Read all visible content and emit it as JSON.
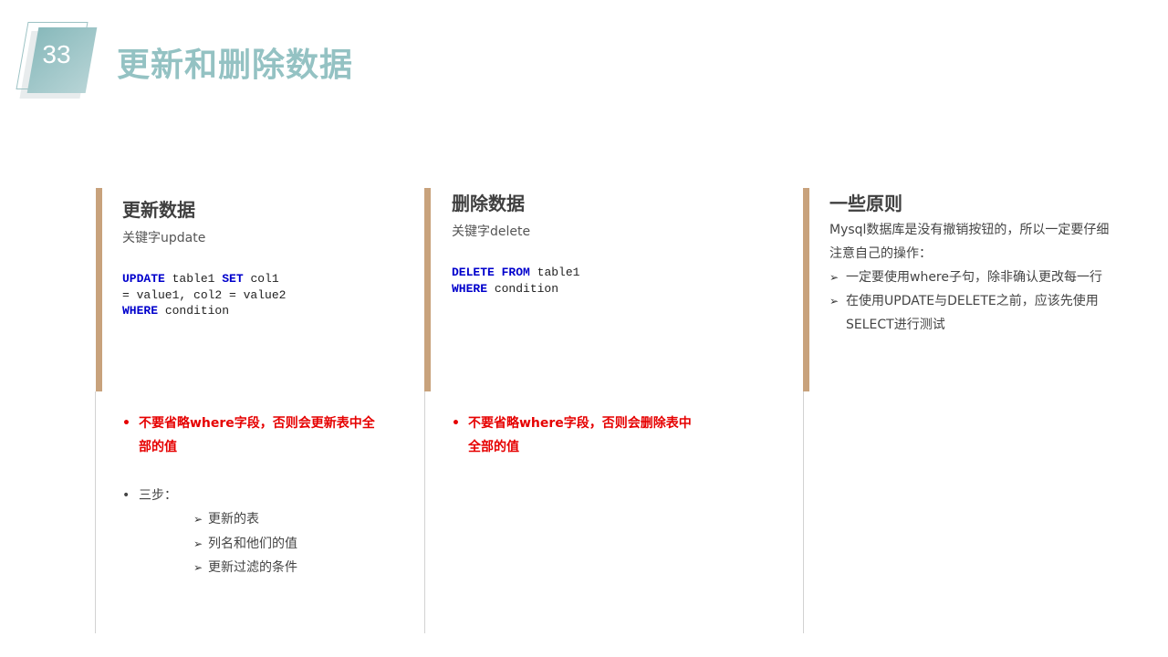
{
  "slide": {
    "number": "33",
    "title": "更新和删除数据"
  },
  "colors": {
    "title": "#94c2c3",
    "accent": "#c8a27c",
    "warning": "#e60000",
    "keyword": "#0000cc"
  },
  "update": {
    "title": "更新数据",
    "keyword_note": "关键字update",
    "code": {
      "line1_kw1": "UPDATE",
      "line1_text1": " table1 ",
      "line1_kw2": "SET",
      "line1_text2": " col1",
      "line2": "= value1, col2 = value2",
      "line3_kw": "WHERE",
      "line3_text": " condition"
    },
    "warning_bullet": "•",
    "warning": "不要省略where字段，否则会更新表中全部的值",
    "steps_bullet": "•",
    "steps_label": "三步：",
    "steps": [
      "更新的表",
      "列名和他们的值",
      "更新过滤的条件"
    ]
  },
  "delete": {
    "title": "删除数据",
    "keyword_note": "关键字delete",
    "code": {
      "line1_kw1": "DELETE",
      "line1_sp": " ",
      "line1_kw2": "FROM",
      "line1_text": " table1",
      "line2_kw": "WHERE",
      "line2_text": " condition"
    },
    "warning_bullet": "•",
    "warning": "不要省略where字段，否则会删除表中全部的值"
  },
  "principles": {
    "title": "一些原则",
    "intro": "Mysql数据库是没有撤销按钮的，所以一定要仔细注意自己的操作：",
    "items": [
      "一定要使用where子句，除非确认更改每一行",
      "在使用UPDATE与DELETE之前，应该先使用SELECT进行测试"
    ]
  }
}
